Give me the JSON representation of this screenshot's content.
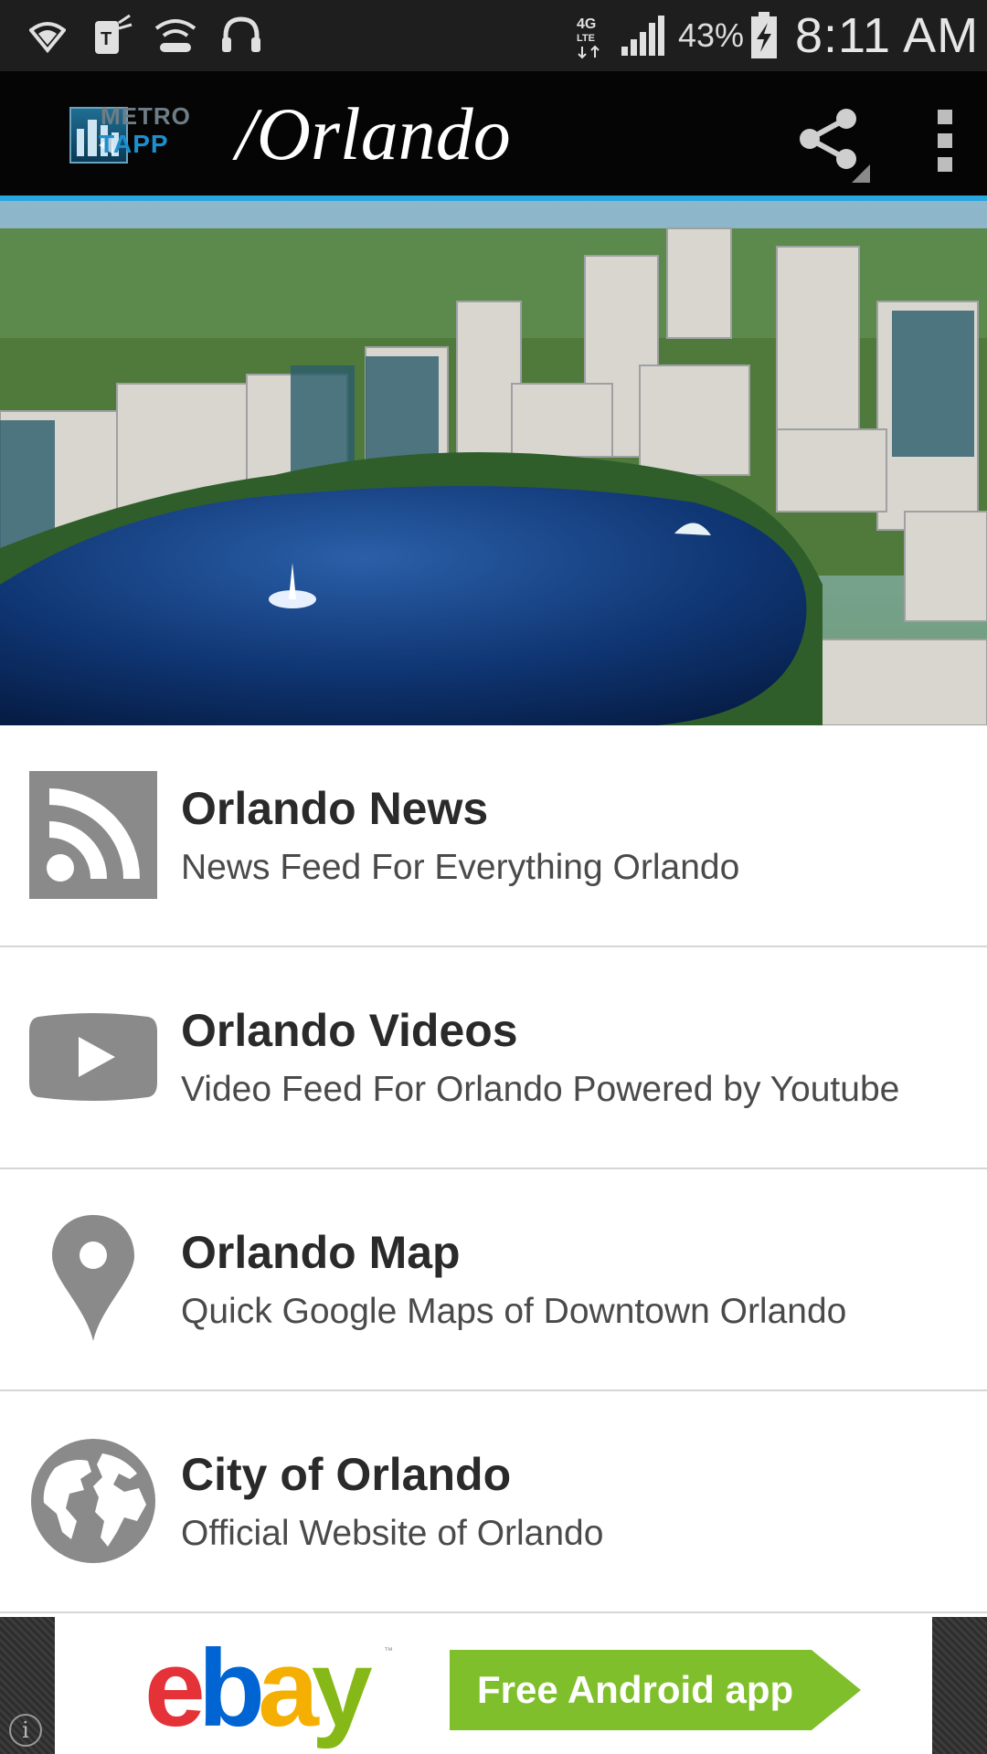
{
  "status_bar": {
    "battery_percent": "43%",
    "time": "8:11 AM",
    "network": "4G LTE",
    "icons": [
      "wifi-shield-icon",
      "t-mobile-icon",
      "wifi-calling-icon",
      "headset-icon",
      "lte-icon",
      "signal-icon",
      "battery-charging-icon"
    ]
  },
  "action_bar": {
    "logo_metro": "METRO",
    "logo_tapp": "TAPP",
    "logo_city": "/Orlando",
    "share_icon": "share-icon",
    "overflow_icon": "overflow-menu-icon"
  },
  "menu": {
    "items": [
      {
        "title": "Orlando News",
        "subtitle": "News Feed For Everything Orlando",
        "icon": "rss-icon"
      },
      {
        "title": "Orlando Videos",
        "subtitle": "Video Feed For Orlando Powered by Youtube",
        "icon": "play-video-icon"
      },
      {
        "title": "Orlando Map",
        "subtitle": "Quick Google Maps of Downtown Orlando",
        "icon": "map-pin-icon"
      },
      {
        "title": "City of Orlando",
        "subtitle": "Official Website of Orlando",
        "icon": "globe-icon"
      }
    ]
  },
  "ad": {
    "logo_e": "e",
    "logo_b": "b",
    "logo_a": "a",
    "logo_y": "y",
    "trademark": "™",
    "cta": "Free Android app",
    "info_glyph": "i"
  },
  "colors": {
    "status_bar_bg": "#1e1e1e",
    "action_bar_bg": "#050505",
    "accent_line": "#2aa6e0",
    "icon_gray": "#8a8a8a",
    "ad_green": "#7fbf2c"
  }
}
